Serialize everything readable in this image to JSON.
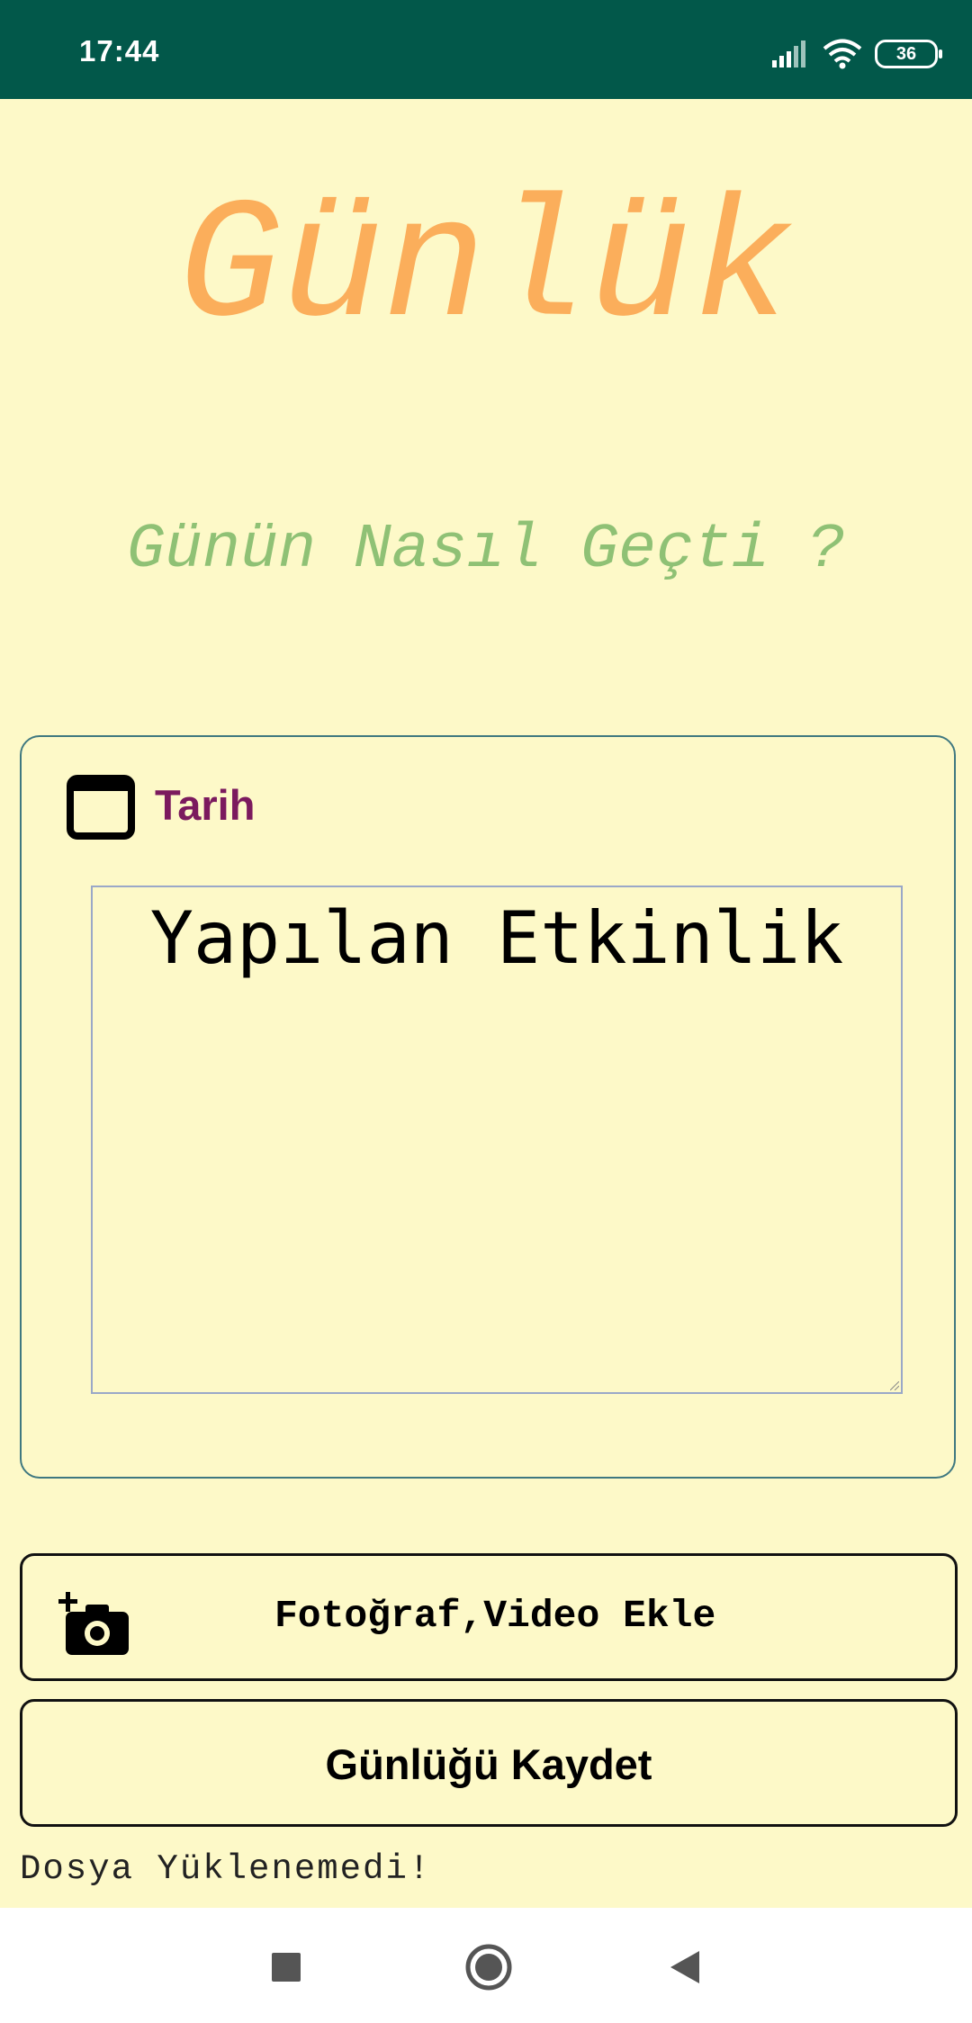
{
  "status_bar": {
    "time": "17:44",
    "battery_level": "36",
    "icons": [
      "signal-icon",
      "wifi-icon",
      "battery-icon"
    ]
  },
  "header": {
    "title": "Günlük",
    "subtitle": "Günün Nasıl Geçti ?"
  },
  "entry_card": {
    "date_icon": "calendar-icon",
    "date_label": "Tarih",
    "activity_placeholder": "Yapılan Etkinlik"
  },
  "actions": {
    "media_icon": "add-photo-camera-icon",
    "media_label": "Fotoğraf,Video Ekle",
    "save_label": "Günlüğü Kaydet"
  },
  "status_message": "Dosya Yüklenemedi!",
  "nav_bar": {
    "icons": [
      "recents-square-icon",
      "home-circle-icon",
      "back-triangle-icon"
    ]
  },
  "colors": {
    "status_bar": "#02584a",
    "background": "#fdf9c8",
    "title": "#fbae5b",
    "subtitle": "#8fc175",
    "date_label": "#7b1a5e",
    "card_border": "#3f7880"
  }
}
